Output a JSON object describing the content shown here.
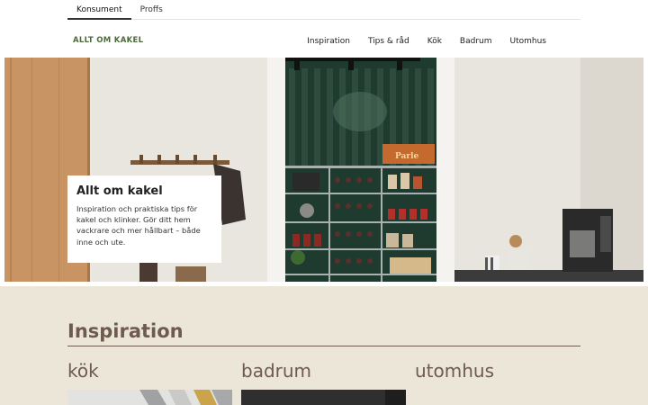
{
  "audience_tabs": [
    {
      "label": "Konsument",
      "active": true
    },
    {
      "label": "Proffs",
      "active": false
    }
  ],
  "header": {
    "logo": "ALLT OM KAKEL",
    "nav": [
      "Inspiration",
      "Tips & råd",
      "Kök",
      "Badrum",
      "Utomhus"
    ]
  },
  "hero": {
    "title": "Allt om kakel",
    "text": "Inspiration och praktiska tips för kakel och klinker. Gör ditt hem vackrare och mer hållbart – både inne och ute.",
    "crate_label": "Parle"
  },
  "inspiration": {
    "title": "Inspiration",
    "categories": [
      "kök",
      "badrum",
      "utomhus"
    ]
  },
  "colors": {
    "brand_green": "#4b6a3a",
    "accent_brown": "#6e5a4f",
    "section_bg": "#ebe6d8"
  }
}
